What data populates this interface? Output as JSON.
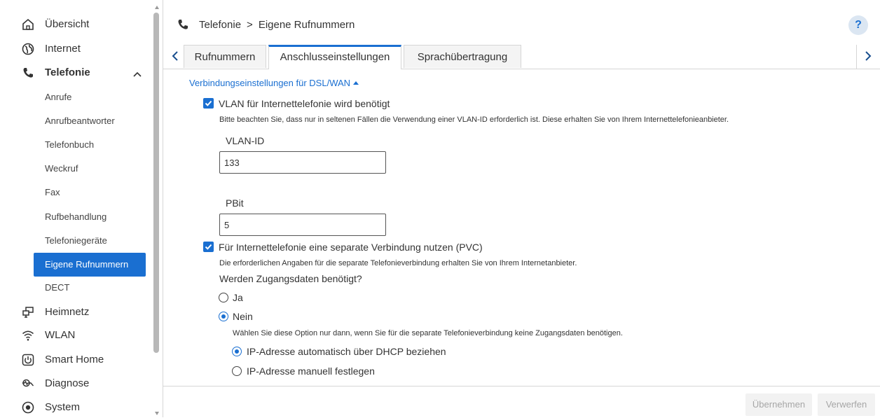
{
  "sidebar": {
    "items": [
      {
        "label": "Übersicht",
        "icon": "home-icon"
      },
      {
        "label": "Internet",
        "icon": "globe-icon"
      },
      {
        "label": "Telefonie",
        "icon": "phone-icon"
      },
      {
        "label": "Heimnetz",
        "icon": "network-icon"
      },
      {
        "label": "WLAN",
        "icon": "wifi-icon"
      },
      {
        "label": "Smart Home",
        "icon": "power-icon"
      },
      {
        "label": "Diagnose",
        "icon": "diagnose-icon"
      },
      {
        "label": "System",
        "icon": "system-icon"
      }
    ],
    "telefonie_sub": [
      {
        "label": "Anrufe"
      },
      {
        "label": "Anrufbeantworter"
      },
      {
        "label": "Telefonbuch"
      },
      {
        "label": "Weckruf"
      },
      {
        "label": "Fax"
      },
      {
        "label": "Rufbehandlung"
      },
      {
        "label": "Telefoniegeräte"
      },
      {
        "label": "Eigene Rufnummern"
      },
      {
        "label": "DECT"
      }
    ]
  },
  "header": {
    "breadcrumb_root": "Telefonie",
    "breadcrumb_sep": ">",
    "breadcrumb_current": "Eigene Rufnummern",
    "help_label": "?"
  },
  "tabs": [
    {
      "label": "Rufnummern"
    },
    {
      "label": "Anschlusseinstellungen"
    },
    {
      "label": "Sprachübertragung"
    }
  ],
  "content": {
    "section_title": "Verbindungseinstellungen für DSL/WAN",
    "vlan_checkbox_label": "VLAN für Internettelefonie wird benötigt",
    "vlan_hint": "Bitte beachten Sie, dass nur in seltenen Fällen die Verwendung einer VLAN-ID erforderlich ist. Diese erhalten Sie von Ihrem Internettelefonieanbieter.",
    "vlan_id_label": "VLAN-ID",
    "vlan_id_value": "133",
    "pbit_label": "PBit",
    "pbit_value": "5",
    "pvc_checkbox_label": "Für Internettelefonie eine separate Verbindung nutzen (PVC)",
    "pvc_hint": "Die erforderlichen Angaben für die separate Telefonieverbindung erhalten Sie von Ihrem Internetanbieter.",
    "credentials_question": "Werden Zugangsdaten benötigt?",
    "radio_ja": "Ja",
    "radio_nein": "Nein",
    "nein_hint": "Wählen Sie diese Option nur dann, wenn Sie für die separate Telefonieverbindung keine Zugangsdaten benötigen.",
    "radio_dhcp": "IP-Adresse automatisch über DHCP beziehen",
    "radio_manual": "IP-Adresse manuell festlegen"
  },
  "footer": {
    "apply_label": "Übernehmen",
    "discard_label": "Verwerfen"
  },
  "colors": {
    "accent": "#1a6fd1",
    "disabled_text": "#a6a6a6"
  }
}
